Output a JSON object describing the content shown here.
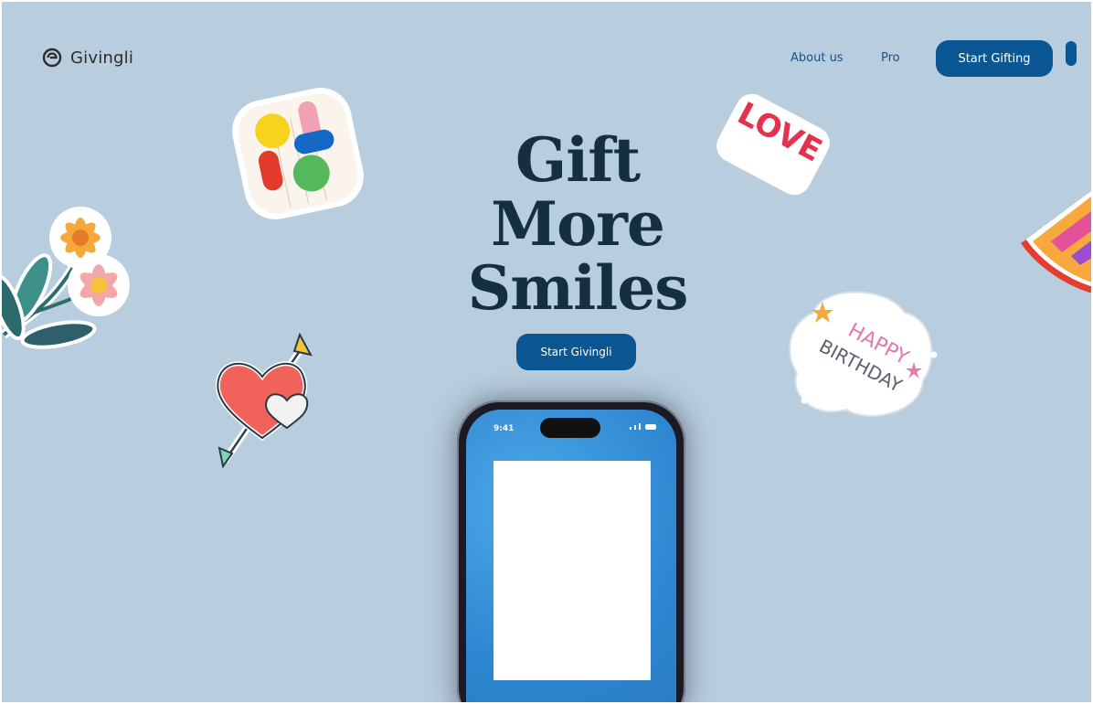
{
  "header": {
    "brand": "Givingli",
    "nav": {
      "about": "About us",
      "pro": "Pro"
    },
    "cta": "Start Gifting"
  },
  "hero": {
    "title_lines": [
      "Gift",
      "More",
      "Smiles"
    ],
    "cta": "Start Givingli"
  },
  "phone": {
    "time": "9:41"
  },
  "stickers": {
    "love": "LOVE",
    "birthday": [
      "HAPPY",
      "BIRTHDAY"
    ]
  },
  "colors": {
    "background": "#b8cddd",
    "primary": "#0b5794",
    "title": "#14303f"
  }
}
